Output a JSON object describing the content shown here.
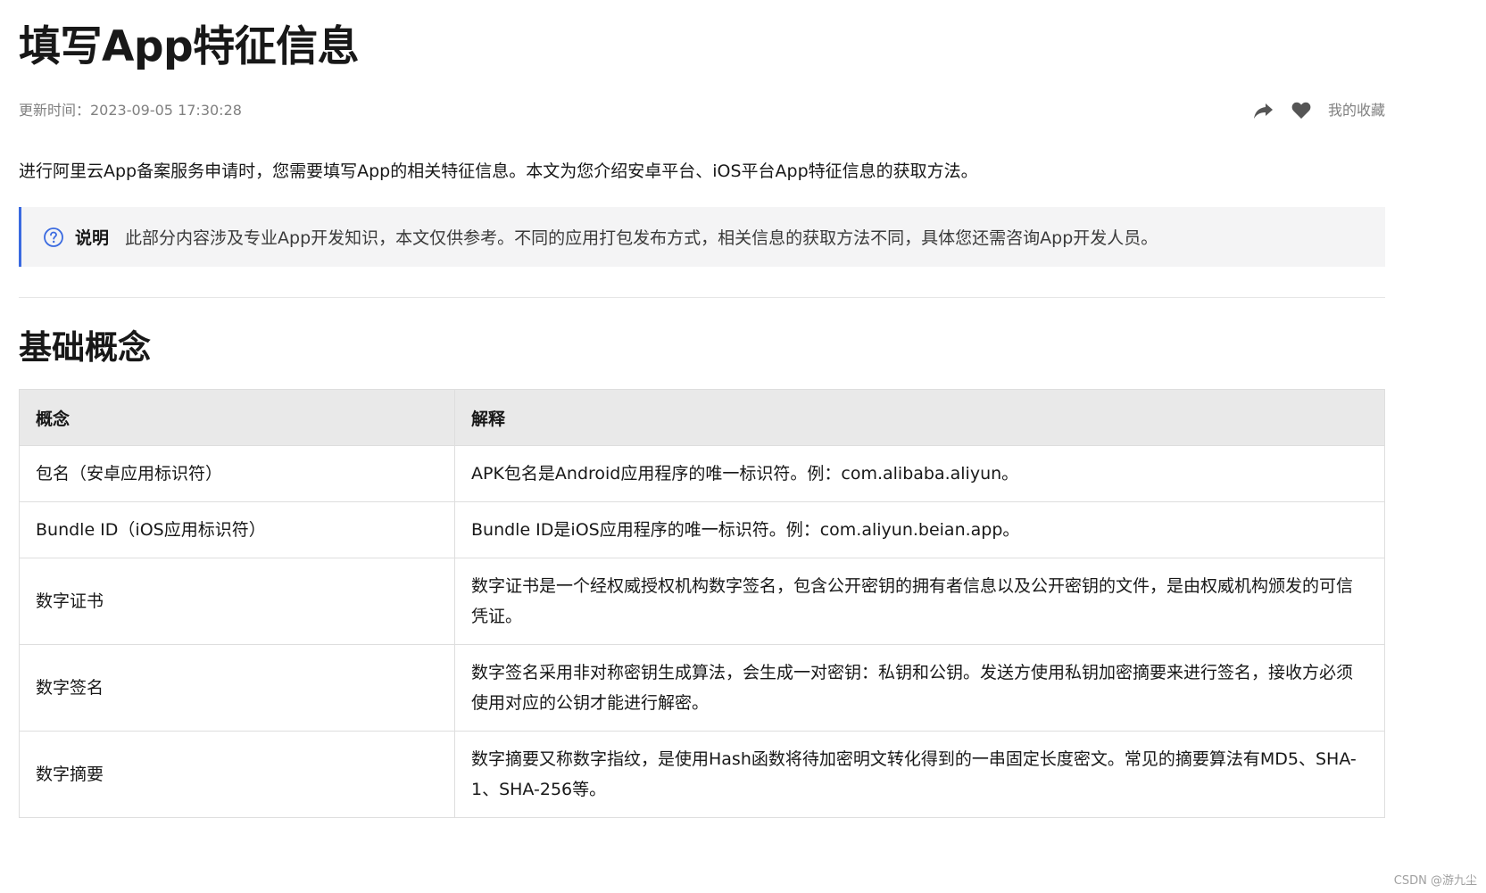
{
  "title": "填写App特征信息",
  "meta": {
    "updated": "更新时间：2023-09-05 17:30:28",
    "favorite_label": "我的收藏",
    "share_icon": "share-icon",
    "heart_icon": "heart-icon"
  },
  "intro": "进行阿里云App备案服务申请时，您需要填写App的相关特征信息。本文为您介绍安卓平台、iOS平台App特征信息的获取方法。",
  "note": {
    "label": "说明",
    "text": "此部分内容涉及专业App开发知识，本文仅供参考。不同的应用打包发布方式，相关信息的获取方法不同，具体您还需咨询App开发人员。",
    "accent_color": "#3a6ae0"
  },
  "section_title": "基础概念",
  "table": {
    "headers": [
      "概念",
      "解释"
    ],
    "rows": [
      [
        "包名（安卓应用标识符）",
        "APK包名是Android应用程序的唯一标识符。例：com.alibaba.aliyun。"
      ],
      [
        "Bundle ID（iOS应用标识符）",
        "Bundle ID是iOS应用程序的唯一标识符。例：com.aliyun.beian.app。"
      ],
      [
        "数字证书",
        "数字证书是一个经权威授权机构数字签名，包含公开密钥的拥有者信息以及公开密钥的文件，是由权威机构颁发的可信凭证。"
      ],
      [
        "数字签名",
        "数字签名采用非对称密钥生成算法，会生成一对密钥：私钥和公钥。发送方使用私钥加密摘要来进行签名，接收方必须使用对应的公钥才能进行解密。"
      ],
      [
        "数字摘要",
        "数字摘要又称数字指纹，是使用Hash函数将待加密明文转化得到的一串固定长度密文。常见的摘要算法有MD5、SHA-1、SHA-256等。"
      ]
    ]
  },
  "watermark": "CSDN @游九尘"
}
